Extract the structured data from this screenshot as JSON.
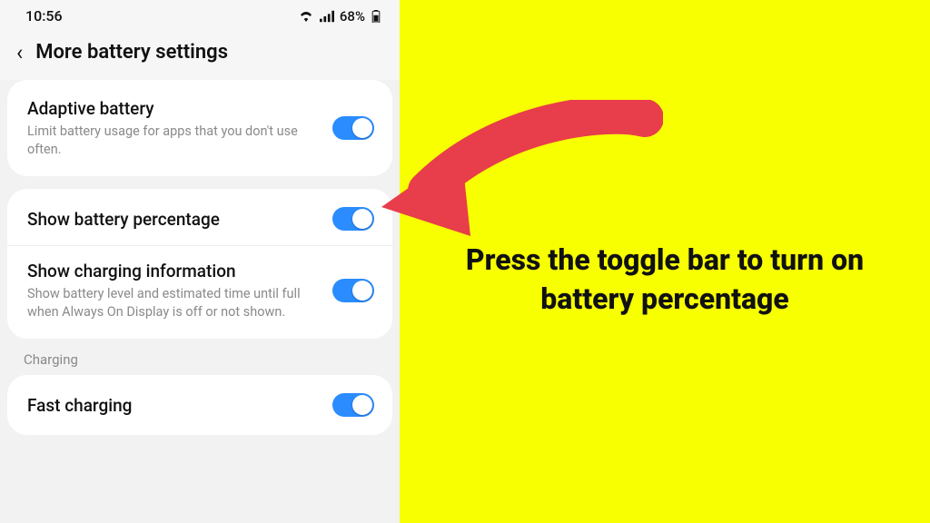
{
  "status": {
    "time": "10:56",
    "battery_percent": "68%"
  },
  "header": {
    "title": "More battery settings"
  },
  "settings": {
    "adaptive": {
      "label": "Adaptive battery",
      "sub": "Limit battery usage for apps that you don't use often."
    },
    "show_pct": {
      "label": "Show battery percentage"
    },
    "show_charging_info": {
      "label": "Show charging information",
      "sub": "Show battery level and estimated time until full when Always On Display is off or not shown."
    },
    "charging_section": "Charging",
    "fast_charging": {
      "label": "Fast charging"
    }
  },
  "annotation": {
    "text": "Press the toggle bar to turn on battery percentage",
    "arrow_color": "#e83d4a"
  }
}
